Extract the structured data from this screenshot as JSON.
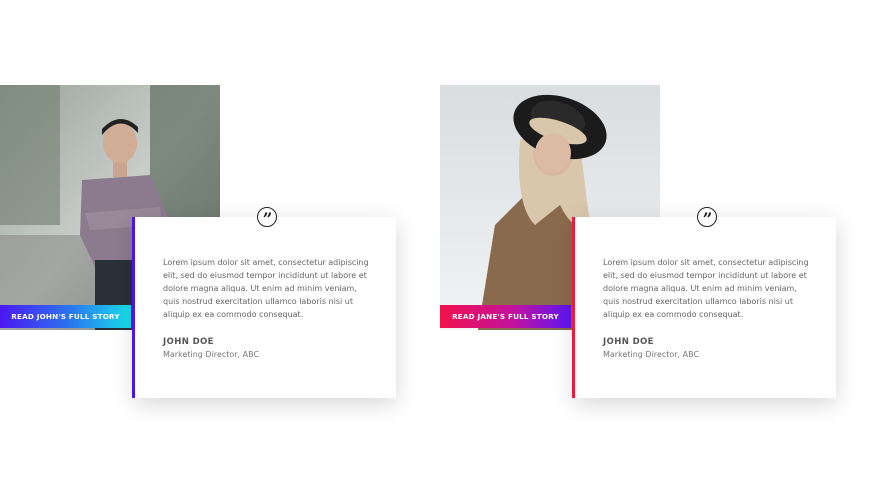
{
  "testimonials": [
    {
      "photo_icon": "person-photo-icon",
      "cta_label": "READ JOHN'S FULL STORY",
      "body": "Lorem ipsum dolor sit amet, consectetur adipiscing elit, sed do eiusmod tempor incididunt ut labore et dolore magna aliqua. Ut enim ad minim veniam, quis nostrud exercitation ullamco laboris nisi ut aliquip ex ea commodo consequat.",
      "name": "JOHN DOE",
      "title": "Marketing Director, ABC",
      "accent_color": "#4a16f0"
    },
    {
      "photo_icon": "person-photo-icon",
      "cta_label": "READ JANE'S FULL STORY",
      "body": "Lorem ipsum dolor sit amet, consectetur adipiscing elit, sed do eiusmod tempor incididunt ut labore et dolore magna aliqua. Ut enim ad minim veniam, quis nostrud exercitation ullamco laboris nisi ut aliquip ex ea commodo consequat.",
      "name": "JOHN DOE",
      "title": "Marketing Director, ABC",
      "accent_color": "#ee1a3c"
    }
  ],
  "quote_glyph": "”"
}
